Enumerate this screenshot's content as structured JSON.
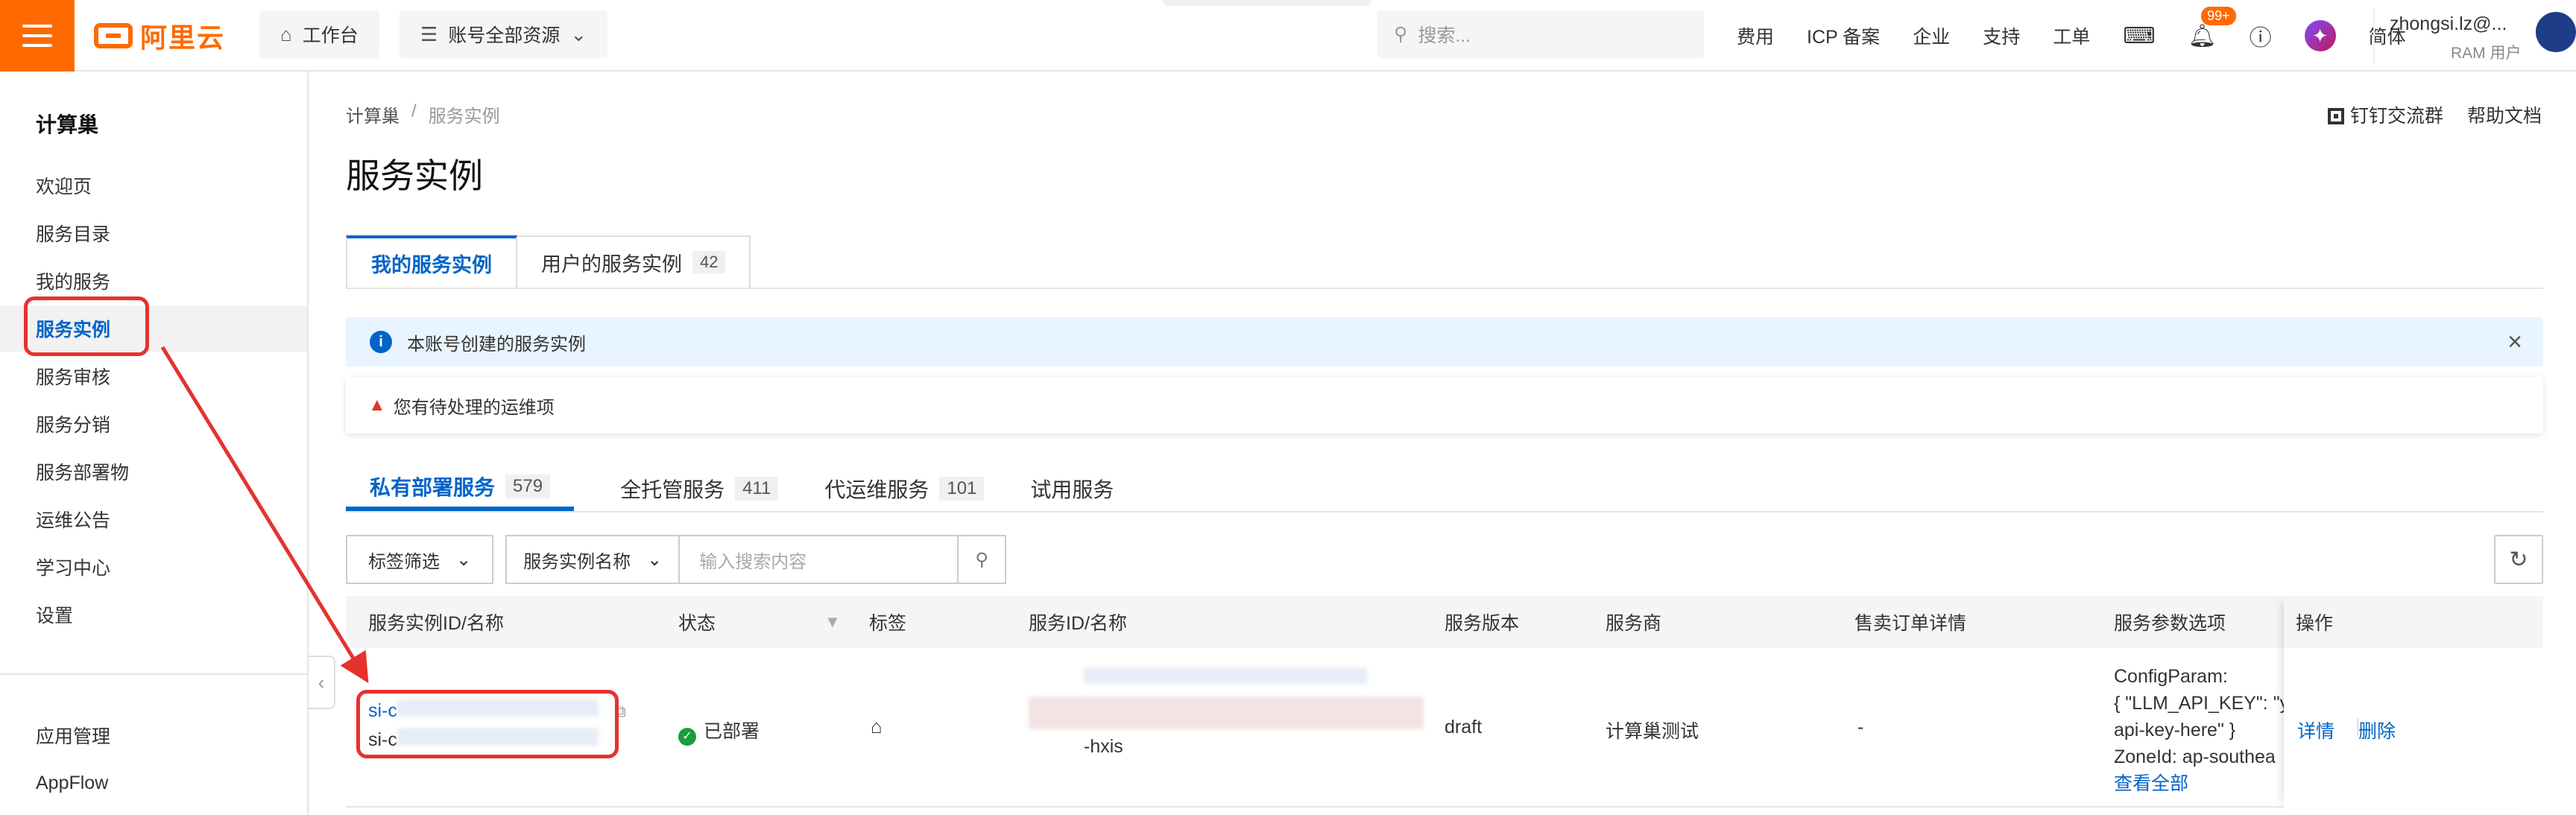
{
  "header": {
    "logo_text": "阿里云",
    "workbench": "工作台",
    "resources": "账号全部资源",
    "search_placeholder": "搜索...",
    "links": [
      "费用",
      "ICP 备案",
      "企业",
      "支持",
      "工单"
    ],
    "notifications_badge": "99+",
    "language": "简体",
    "user_name": "zhongsi.lz@...",
    "user_role": "RAM 用户"
  },
  "sidebar": {
    "title": "计算巢",
    "items": [
      {
        "label": "欢迎页",
        "active": false
      },
      {
        "label": "服务目录",
        "active": false
      },
      {
        "label": "我的服务",
        "active": false
      },
      {
        "label": "服务实例",
        "active": true
      },
      {
        "label": "服务审核",
        "active": false
      },
      {
        "label": "服务分销",
        "active": false
      },
      {
        "label": "服务部署物",
        "active": false
      },
      {
        "label": "运维公告",
        "active": false
      },
      {
        "label": "学习中心",
        "active": false
      },
      {
        "label": "设置",
        "active": false
      }
    ],
    "bottom_items": [
      "应用管理",
      "AppFlow"
    ]
  },
  "main": {
    "breadcrumb": [
      "计算巢",
      "服务实例"
    ],
    "breadcrumb_sep": "/",
    "right_links": [
      "钉钉交流群",
      "帮助文档"
    ],
    "title": "服务实例",
    "top_tabs": [
      {
        "label": "我的服务实例",
        "count": ""
      },
      {
        "label": "用户的服务实例",
        "count": "42"
      }
    ],
    "info_text": "本账号创建的服务实例",
    "ops_text": "您有待处理的运维项",
    "sub_tabs": [
      {
        "label": "私有部署服务",
        "count": "579"
      },
      {
        "label": "全托管服务",
        "count": "411"
      },
      {
        "label": "代运维服务",
        "count": "101"
      },
      {
        "label": "试用服务",
        "count": ""
      }
    ],
    "filters": {
      "tag_filter": "标签筛选",
      "name_select": "服务实例名称",
      "search_placeholder": "输入搜索内容"
    },
    "table": {
      "columns": [
        "服务实例ID/名称",
        "状态",
        "标签",
        "服务ID/名称",
        "服务版本",
        "服务商",
        "售卖订单详情",
        "服务参数选项",
        "操作"
      ],
      "row": {
        "instance_id_prefix_1": "si-c",
        "instance_id_prefix_2": "si-c",
        "status": "已部署",
        "service_suffix": "-hxis",
        "version": "draft",
        "provider": "计算巢测试",
        "order": "-",
        "params": [
          "ConfigParam:",
          "{ \"LLM_API_KEY\": \"y",
          "api-key-here\" }",
          "ZoneId: ap-southea"
        ],
        "view_all": "查看全部",
        "actions": [
          "详情",
          "删除"
        ]
      }
    }
  }
}
